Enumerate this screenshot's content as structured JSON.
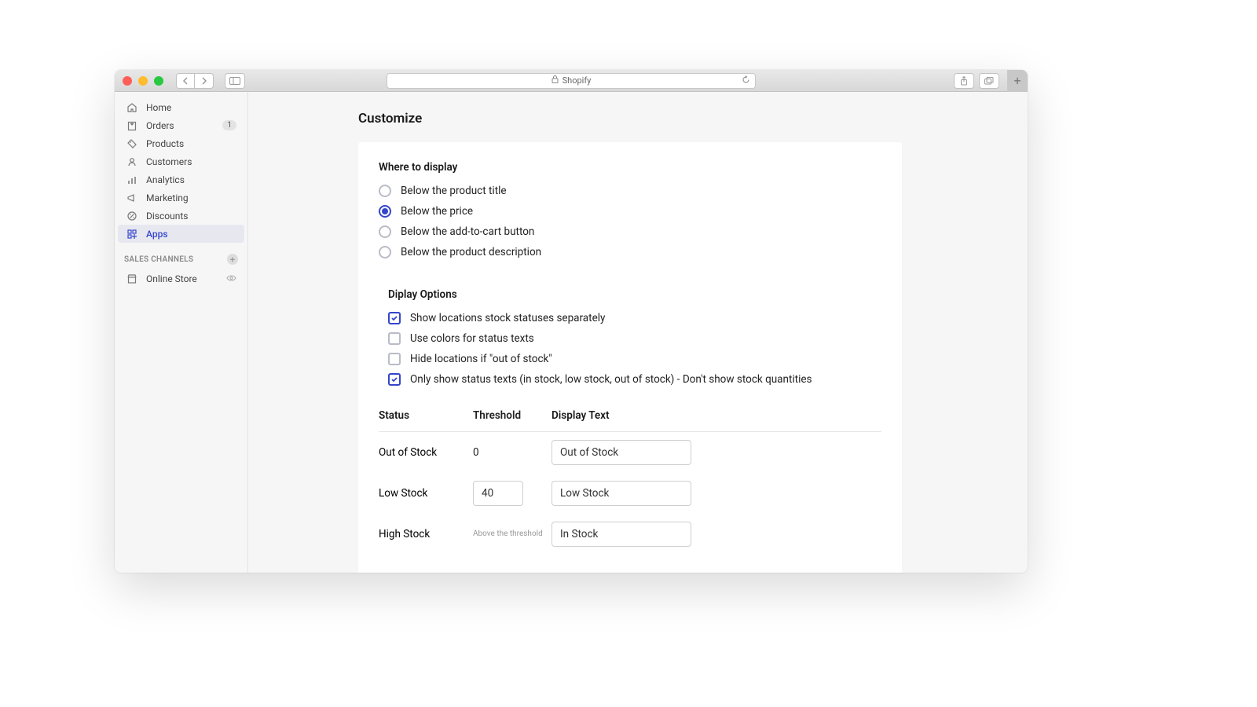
{
  "browser": {
    "address": "Shopify"
  },
  "sidebar": {
    "items": [
      {
        "label": "Home"
      },
      {
        "label": "Orders",
        "badge": "1"
      },
      {
        "label": "Products"
      },
      {
        "label": "Customers"
      },
      {
        "label": "Analytics"
      },
      {
        "label": "Marketing"
      },
      {
        "label": "Discounts"
      },
      {
        "label": "Apps"
      }
    ],
    "section_label": "SALES CHANNELS",
    "channel": "Online Store"
  },
  "page": {
    "title": "Customize",
    "where_title": "Where to display",
    "where_options": [
      "Below the product title",
      "Below the price",
      "Below the add-to-cart button",
      "Below the product description"
    ],
    "display_title": "Diplay Options",
    "display_options": [
      "Show locations stock statuses separately",
      "Use colors for status texts",
      "Hide locations if \"out of stock\"",
      "Only show status texts (in stock, low stock, out of stock) - Don't show stock quantities"
    ],
    "table": {
      "head_status": "Status",
      "head_threshold": "Threshold",
      "head_display": "Display Text",
      "rows": [
        {
          "status": "Out of Stock",
          "threshold": "0",
          "display": "Out of Stock"
        },
        {
          "status": "Low Stock",
          "threshold": "40",
          "display": "Low Stock"
        },
        {
          "status": "High Stock",
          "threshold_hint": "Above the threshold",
          "display": "In Stock"
        }
      ]
    }
  }
}
